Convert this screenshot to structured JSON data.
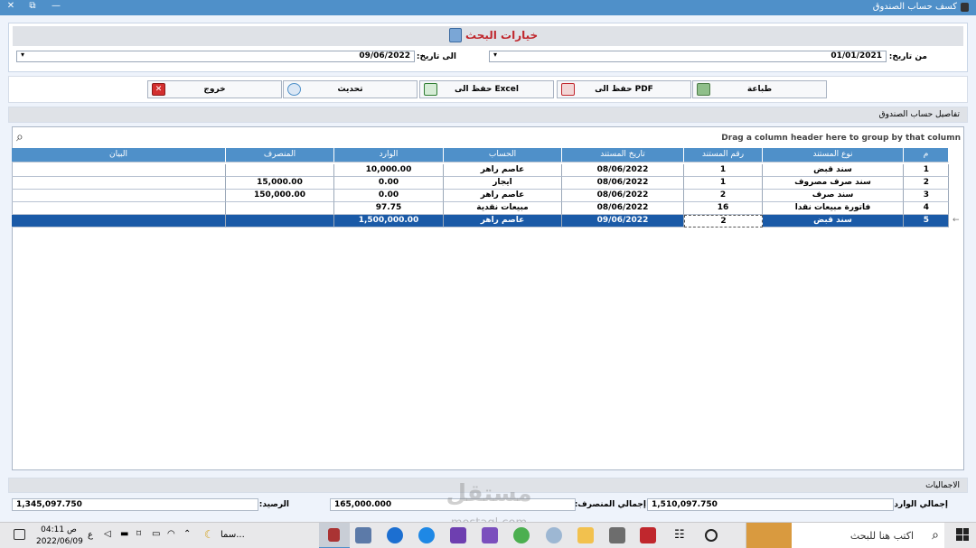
{
  "window": {
    "title": "كسف حساب الصندوق",
    "close": "✕",
    "restore": "⧉",
    "minimize": "—"
  },
  "search": {
    "section_title": "خيارات البحث",
    "from_label": "من تاريخ:",
    "from_value": "01/01/2021",
    "to_label": "الى تاريخ:",
    "to_value": "09/06/2022"
  },
  "toolbar": {
    "print": "طباعة",
    "save_pdf": "حفظ الى PDF",
    "save_excel": "حفظ الى Excel",
    "refresh": "تحديث",
    "exit": "خروج"
  },
  "details": {
    "title": "تفاصيل حساب الصندوق",
    "group_hint": "Drag a column header here to group by that column"
  },
  "table": {
    "headers": {
      "num": "م",
      "doc_type": "نوع المستند",
      "doc_no": "رقم المستند",
      "doc_date": "تاريخ المستند",
      "account": "الحساب",
      "incoming": "الوارد",
      "outgoing": "المنصرف",
      "statement": "البيان"
    },
    "rows": [
      {
        "num": "1",
        "doc_type": "سند قبض",
        "doc_no": "1",
        "doc_date": "08/06/2022",
        "account": "عاصم راهر",
        "incoming": "10,000.00",
        "outgoing": "",
        "statement": ""
      },
      {
        "num": "2",
        "doc_type": "سند صرف مصروف",
        "doc_no": "1",
        "doc_date": "08/06/2022",
        "account": "ايجار",
        "incoming": "0.00",
        "outgoing": "15,000.00",
        "statement": ""
      },
      {
        "num": "3",
        "doc_type": "سند صرف",
        "doc_no": "2",
        "doc_date": "08/06/2022",
        "account": "عاصم راهر",
        "incoming": "0.00",
        "outgoing": "150,000.00",
        "statement": ""
      },
      {
        "num": "4",
        "doc_type": "فاتورة مبيعات نقدا",
        "doc_no": "16",
        "doc_date": "08/06/2022",
        "account": "مبيعات نقدية",
        "incoming": "97.75",
        "outgoing": "",
        "statement": ""
      },
      {
        "num": "5",
        "doc_type": "سند قبض",
        "doc_no": "2",
        "doc_date": "09/06/2022",
        "account": "عاصم راهر",
        "incoming": "1,500,000.00",
        "outgoing": "",
        "statement": ""
      }
    ]
  },
  "totals": {
    "title": "الاجماليات",
    "incoming_label": "إجمالي الوارد:",
    "incoming_value": "1,510,097.750",
    "outgoing_label": "إجمالي المنصرف:",
    "outgoing_value": "165,000.000",
    "balance_label": "الرصيد:",
    "balance_value": "1,345,097.750"
  },
  "taskbar": {
    "search_placeholder": "اكتب هنا للبحث",
    "time": "04:11 ص",
    "date": "2022/06/09",
    "lang": "ع",
    "weather": "سما..."
  },
  "watermark": {
    "line1": "مستقل",
    "line2": "mostaql.com"
  },
  "colors": {
    "header_blue": "#4f90c9",
    "selected_row": "#1a5aa7",
    "title_red": "#c0272d"
  }
}
